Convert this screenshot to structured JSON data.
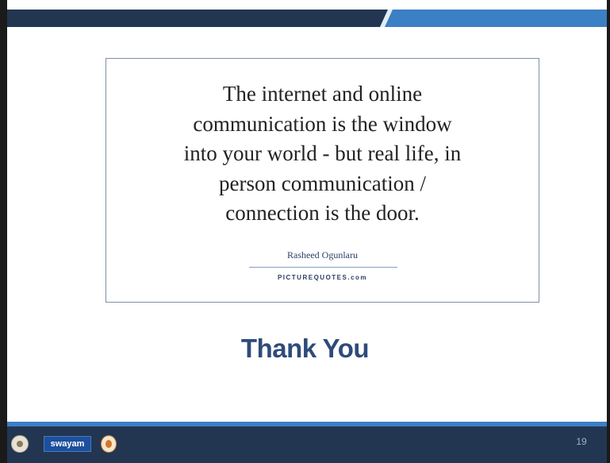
{
  "slide": {
    "quote": "The internet and online\ncommunication is the window\ninto your world - but real life, in\nperson communication /\nconnection is the door.",
    "author": "Rasheed Ogunlaru",
    "source": "PICTUREQUOTES.com",
    "closing": "Thank You",
    "page_number": "19"
  },
  "footer": {
    "logos": [
      {
        "name": "institute-logo"
      },
      {
        "name": "swayam-logo",
        "text": "swayam"
      },
      {
        "name": "nptel-logo"
      }
    ]
  },
  "colors": {
    "header_band": "#3b7fc4",
    "header_dark": "#223652",
    "title_text": "#2e4b7a",
    "footer_bg": "#223652",
    "card_border": "#7f8fa6"
  }
}
